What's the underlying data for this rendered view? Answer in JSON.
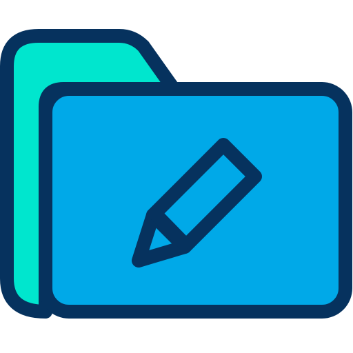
{
  "icon": {
    "name": "edit-folder-icon",
    "colors": {
      "outline": "#06325E",
      "back_tab": "#00E6CE",
      "front_panel": "#00A9E8",
      "pencil_fill": "#00A9E8",
      "background": "#FFFFFF"
    }
  }
}
